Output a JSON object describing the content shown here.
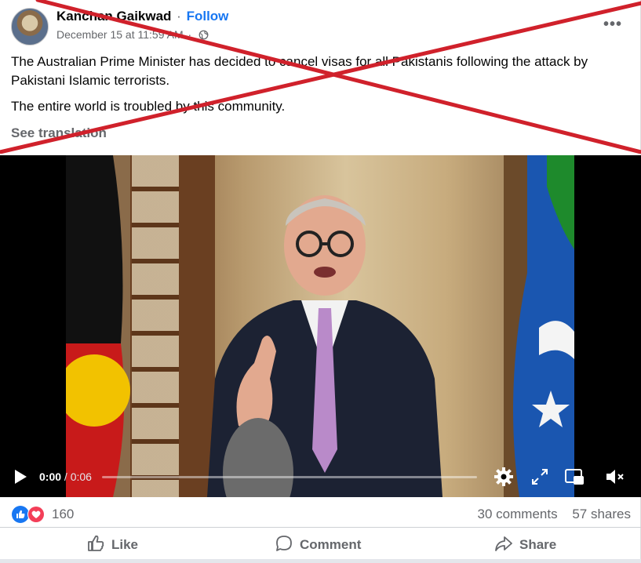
{
  "post": {
    "author": "Kanchan Gaikwad",
    "separator": "·",
    "follow_label": "Follow",
    "timestamp": "December 15 at 11:59 AM",
    "audience_icon": "globe-icon",
    "more_label": "•••",
    "paragraphs": [
      "The Australian Prime Minister has decided to cancel visas for all Pakistanis following the attack by Pakistani Islamic terrorists.",
      "The entire world is troubled by this community."
    ],
    "see_translation": "See translation",
    "overlay_color": "#d0212b"
  },
  "video": {
    "current_time": "0:00",
    "duration": "/ 0:06",
    "progress": 0.0,
    "controls": [
      "play-icon",
      "settings-gear-icon",
      "fullscreen-icon",
      "picture-in-picture-icon",
      "volume-muted-icon"
    ]
  },
  "engagement": {
    "reaction_icons": [
      "like-icon",
      "love-icon"
    ],
    "reaction_count": "160",
    "comments": "30 comments",
    "shares": "57 shares"
  },
  "actions": {
    "like": "Like",
    "comment": "Comment",
    "share": "Share"
  },
  "colors": {
    "accent": "#1877f2",
    "love": "#f33e58",
    "secondary_text": "#65676b"
  }
}
